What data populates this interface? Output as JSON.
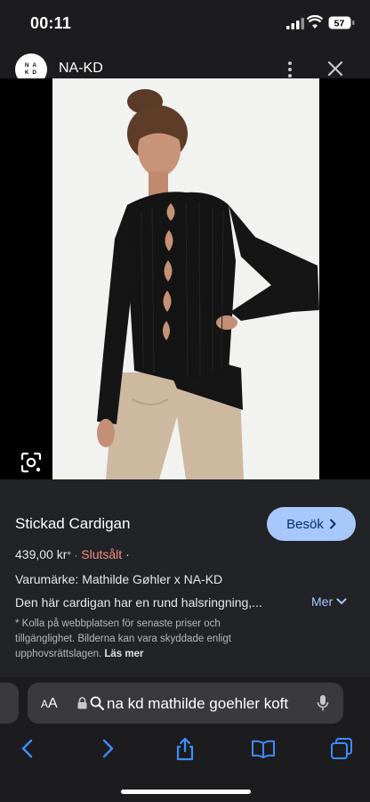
{
  "status": {
    "time": "00:11",
    "battery": "57"
  },
  "site": {
    "logo_text": "NA\nKD",
    "name": "NA-KD"
  },
  "product": {
    "title": "Stickad Cardigan",
    "visit_label": "Besök",
    "price": "439,00 kr",
    "price_suffix": "* ·",
    "availability": "Slutsålt",
    "availability_suffix": "·",
    "brand": "Varumärke: Mathilde Gøhler x NA-KD",
    "description": "Den här cardigan har en rund halsringning,...",
    "more_label": "Mer",
    "note_text": "* Kolla på webbplatsen för senaste priser och tillgänglighet. Bilderna kan vara skyddade enligt upphovsrättslagen.",
    "note_link": "Läs mer"
  },
  "browser": {
    "aa_label": "AA",
    "url_text": "na kd mathilde goehler koft"
  },
  "colors": {
    "accent": "#a8c7fa",
    "sold": "#f28b82",
    "panel": "#222326"
  }
}
